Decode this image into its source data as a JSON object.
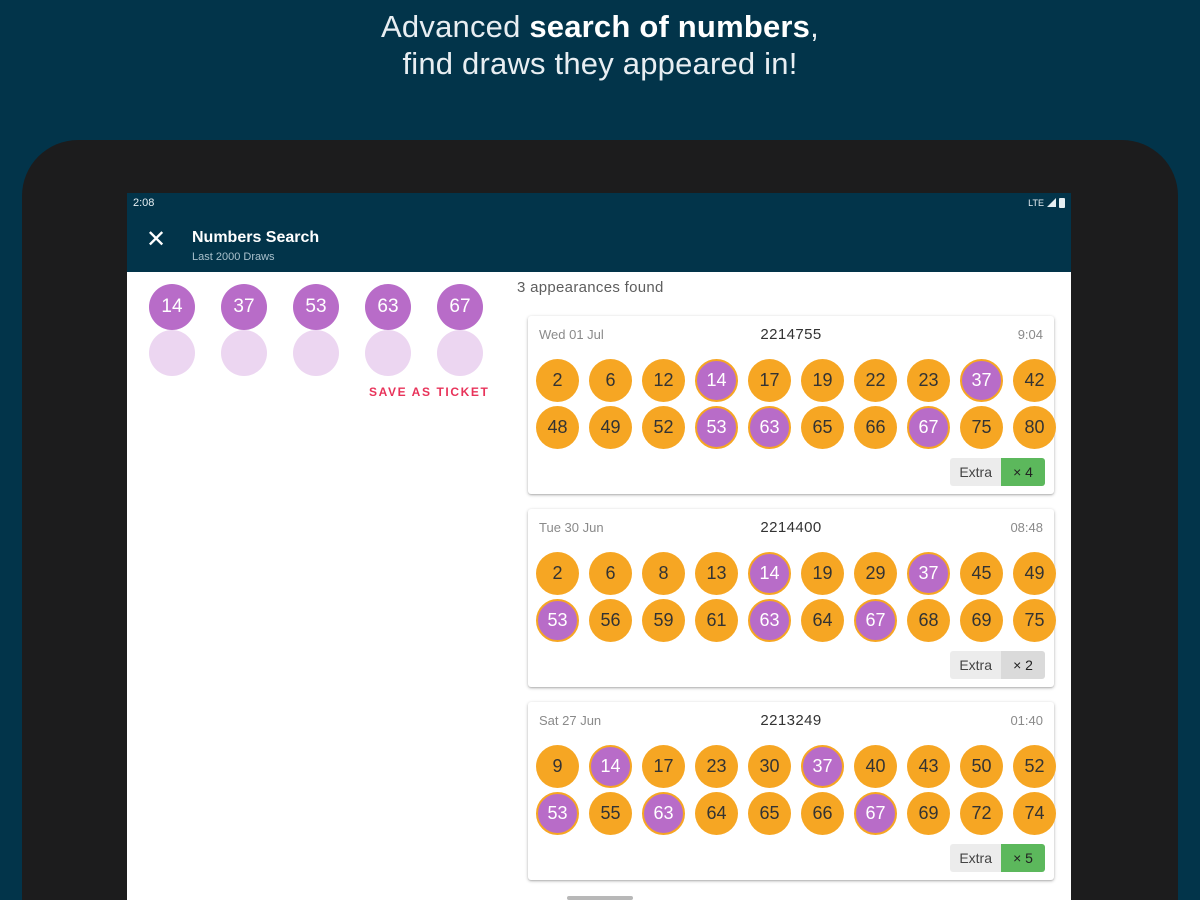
{
  "headline": {
    "prefix": "Advanced ",
    "bold": "search of numbers",
    "suffix": ",",
    "line2": "find draws they appeared in!"
  },
  "statusbar": {
    "time": "2:08",
    "network": "LTE"
  },
  "appbar": {
    "title": "Numbers Search",
    "subtitle": "Last 2000 Draws"
  },
  "selection": {
    "numbers": [
      "14",
      "37",
      "53",
      "63",
      "67"
    ],
    "empty_slots": 5,
    "save_label": "SAVE AS TICKET"
  },
  "results": {
    "count_label": "3 appearances found",
    "draws": [
      {
        "date": "Wed 01 Jul",
        "draw": "2214755",
        "time": "9:04",
        "numbers": [
          "2",
          "6",
          "12",
          "14",
          "17",
          "19",
          "22",
          "23",
          "37",
          "42",
          "48",
          "49",
          "52",
          "53",
          "63",
          "65",
          "66",
          "67",
          "75",
          "80"
        ],
        "extra_label": "Extra",
        "multiplier": "× 4",
        "multiplier_color": "green"
      },
      {
        "date": "Tue 30 Jun",
        "draw": "2214400",
        "time": "08:48",
        "numbers": [
          "2",
          "6",
          "8",
          "13",
          "14",
          "19",
          "29",
          "37",
          "45",
          "49",
          "53",
          "56",
          "59",
          "61",
          "63",
          "64",
          "67",
          "68",
          "69",
          "75"
        ],
        "extra_label": "Extra",
        "multiplier": "× 2",
        "multiplier_color": "gray"
      },
      {
        "date": "Sat 27 Jun",
        "draw": "2213249",
        "time": "01:40",
        "numbers": [
          "9",
          "14",
          "17",
          "23",
          "30",
          "37",
          "40",
          "43",
          "50",
          "52",
          "53",
          "55",
          "63",
          "64",
          "65",
          "66",
          "67",
          "69",
          "72",
          "74"
        ],
        "extra_label": "Extra",
        "multiplier": "× 5",
        "multiplier_color": "green"
      }
    ]
  },
  "colors": {
    "background": "#02344a",
    "ball_orange": "#f6a623",
    "ball_purple": "#b86cc8",
    "ball_empty": "#ecd6f1",
    "accent_red": "#e8335a",
    "extra_green": "#5cb85c"
  }
}
